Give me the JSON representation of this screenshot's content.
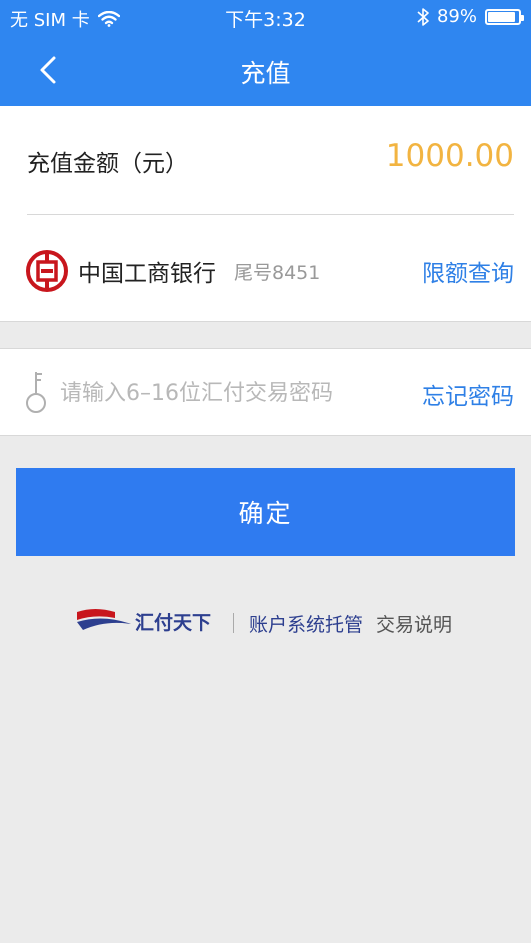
{
  "status_bar": {
    "carrier": "无 SIM 卡",
    "time": "下午3:32",
    "battery": "89%",
    "battery_level": 0.89
  },
  "nav": {
    "title": "充值"
  },
  "amount": {
    "label": "充值金额（元）",
    "value": "1000.00"
  },
  "bank": {
    "name": "中国工商银行",
    "tail": "尾号8451",
    "limit_link": "限额查询"
  },
  "password": {
    "placeholder": "请输入6–16位汇付交易密码",
    "value": "",
    "forgot_link": "忘记密码"
  },
  "confirm": {
    "label": "确定"
  },
  "footer": {
    "brand": "汇付天下",
    "desc": "账户系统托管",
    "link": "交易说明"
  },
  "colors": {
    "primary": "#2f86f0",
    "amount": "#f2b441",
    "link": "#2f80e6",
    "background": "#ebebeb"
  },
  "icons": {
    "back": "chevron-left-icon",
    "wifi": "wifi-icon",
    "bluetooth": "bluetooth-icon",
    "battery": "battery-icon",
    "bank_logo": "icbc-logo",
    "key": "key-icon",
    "brand_logo": "chinapnr-logo"
  }
}
